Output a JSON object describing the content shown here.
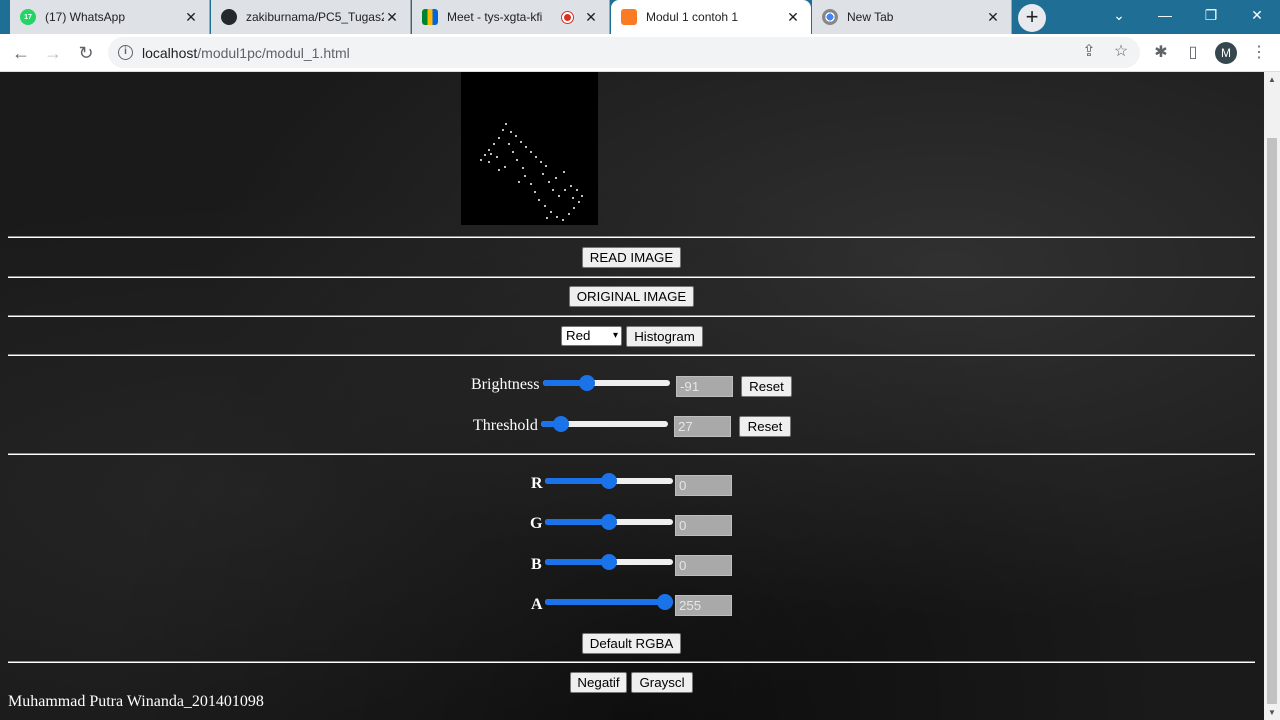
{
  "browser": {
    "tabs": [
      {
        "title": "(17) WhatsApp",
        "badge": "17",
        "active": false
      },
      {
        "title": "zakiburnama/PC5_Tugas2",
        "active": false
      },
      {
        "title": "Meet - tys-xgta-kfi",
        "active": false
      },
      {
        "title": "Modul 1 contoh 1",
        "active": true
      },
      {
        "title": "New Tab",
        "active": false
      }
    ],
    "url_host": "localhost",
    "url_path": "/modul1pc/modul_1.html",
    "profile_initial": "M"
  },
  "page": {
    "read_image_label": "READ IMAGE",
    "original_image_label": "ORIGINAL IMAGE",
    "channel_select_value": "Red",
    "histogram_label": "Histogram",
    "brightness": {
      "label": "Brightness",
      "value": "-91",
      "min": -255,
      "max": 255,
      "reset_label": "Reset"
    },
    "threshold": {
      "label": "Threshold",
      "value": "27",
      "min": 0,
      "max": 255,
      "reset_label": "Reset"
    },
    "rgba": [
      {
        "label": "R",
        "value": "0",
        "min": -255,
        "max": 255
      },
      {
        "label": "G",
        "value": "0",
        "min": -255,
        "max": 255
      },
      {
        "label": "B",
        "value": "0",
        "min": -255,
        "max": 255
      },
      {
        "label": "A",
        "value": "255",
        "min": 0,
        "max": 255
      }
    ],
    "default_rgba_label": "Default RGBA",
    "negatif_label": "Negatif",
    "grayscale_label": "Grayscl",
    "footer_name": "Muhammad Putra Winanda_201401098"
  }
}
